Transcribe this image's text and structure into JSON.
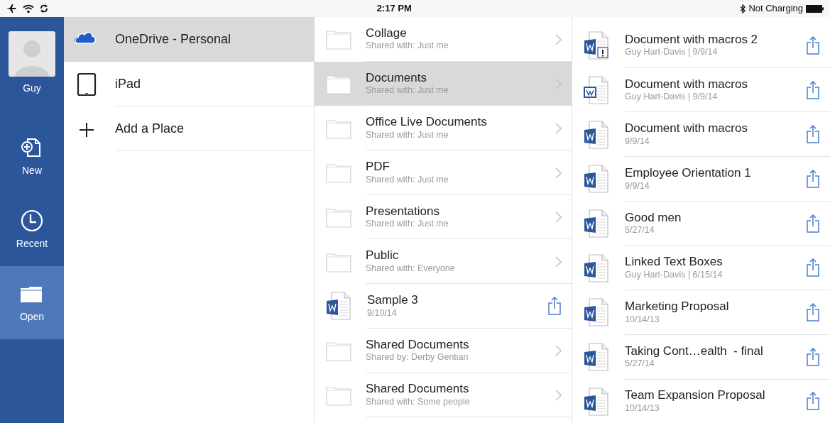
{
  "status_bar": {
    "time": "2:17 PM",
    "battery_text": "Not Charging"
  },
  "rail": {
    "profile": {
      "name": "Guy"
    },
    "items": [
      {
        "label": "New",
        "kind": "new",
        "selected": false
      },
      {
        "label": "Recent",
        "kind": "recent",
        "selected": false
      },
      {
        "label": "Open",
        "kind": "open",
        "selected": true
      }
    ]
  },
  "places": [
    {
      "label": "OneDrive - Personal",
      "kind": "cloud",
      "selected": true
    },
    {
      "label": "iPad",
      "kind": "tablet",
      "selected": false
    },
    {
      "label": "Add a Place",
      "kind": "add",
      "selected": false
    }
  ],
  "folders": [
    {
      "title": "Collage",
      "subtitle": "Shared with: Just me",
      "kind": "folder",
      "selected": false
    },
    {
      "title": "Documents",
      "subtitle": "Shared with: Just me",
      "kind": "folder",
      "selected": true
    },
    {
      "title": "Office Live Documents",
      "subtitle": "Shared with: Just me",
      "kind": "folder",
      "selected": false
    },
    {
      "title": "PDF",
      "subtitle": "Shared with: Just me",
      "kind": "folder",
      "selected": false
    },
    {
      "title": "Presentations",
      "subtitle": "Shared with: Just me",
      "kind": "folder",
      "selected": false
    },
    {
      "title": "Public",
      "subtitle": "Shared with: Everyone",
      "kind": "folder",
      "selected": false
    },
    {
      "title": "Sample 3",
      "subtitle": "9/10/14",
      "kind": "document",
      "selected": false
    },
    {
      "title": "Shared Documents",
      "subtitle": "Shared by: Derby Gentian",
      "kind": "folder",
      "selected": false
    },
    {
      "title": "Shared Documents",
      "subtitle": "Shared with: Some people",
      "kind": "folder",
      "selected": false
    }
  ],
  "documents": [
    {
      "title": "Document with macros 2",
      "subtitle": "Guy Hart-Davis | 9/9/14",
      "kind": "macro"
    },
    {
      "title": "Document with macros",
      "subtitle": "Guy Hart-Davis | 9/9/14",
      "kind": "legacy"
    },
    {
      "title": "Document with macros",
      "subtitle": "9/9/14",
      "kind": "word"
    },
    {
      "title": "Employee Orientation 1",
      "subtitle": "9/9/14",
      "kind": "word"
    },
    {
      "title": "Good men",
      "subtitle": "5/27/14",
      "kind": "word"
    },
    {
      "title": "Linked Text Boxes",
      "subtitle": "Guy Hart-Davis | 6/15/14",
      "kind": "word"
    },
    {
      "title": "Marketing Proposal",
      "subtitle": "10/14/13",
      "kind": "word"
    },
    {
      "title": "Taking Cont…ealth  - final",
      "subtitle": "5/27/14",
      "kind": "word"
    },
    {
      "title": "Team Expansion Proposal",
      "subtitle": "10/14/13",
      "kind": "word"
    }
  ]
}
